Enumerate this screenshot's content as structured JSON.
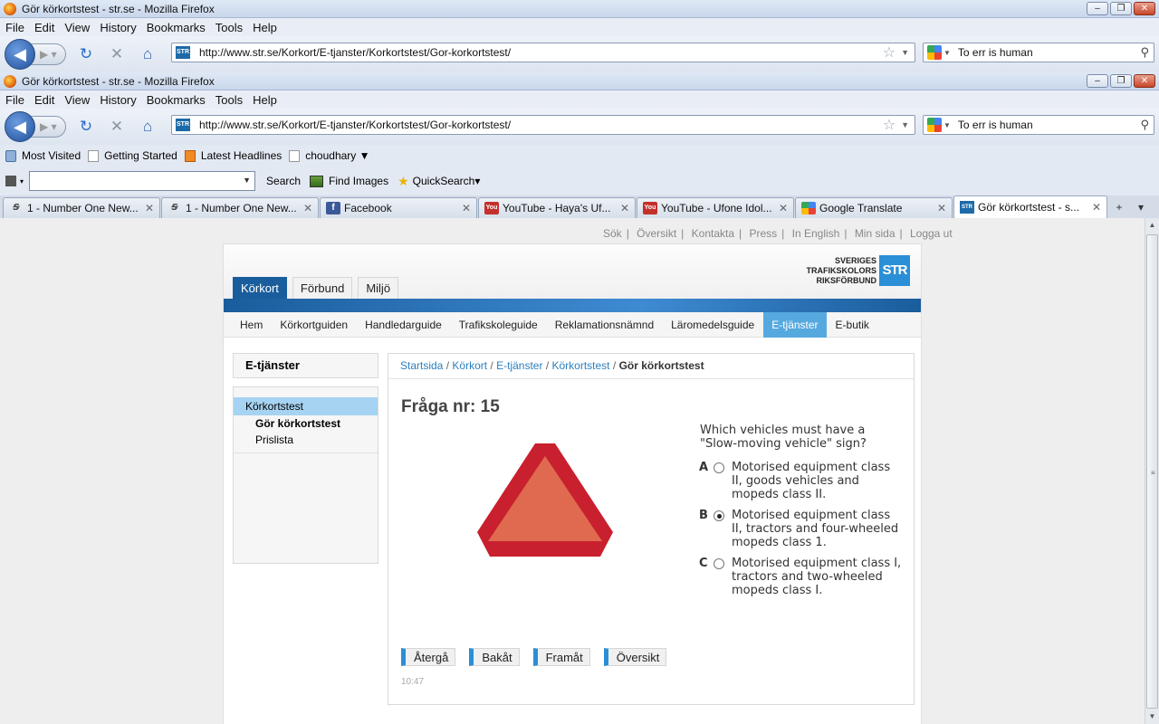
{
  "browser_back": {
    "title": "Gör körkortstest - str.se - Mozilla Firefox",
    "menu": [
      "File",
      "Edit",
      "View",
      "History",
      "Bookmarks",
      "Tools",
      "Help"
    ],
    "url": "http://www.str.se/Korkort/E-tjanster/Korkortstest/Gor-korkortstest/",
    "search": "To err is human"
  },
  "browser": {
    "title": "Gör körkortstest - str.se - Mozilla Firefox",
    "menu": [
      "File",
      "Edit",
      "View",
      "History",
      "Bookmarks",
      "Tools",
      "Help"
    ],
    "url": "http://www.str.se/Korkort/E-tjanster/Korkortstest/Gor-korkortstest/",
    "search": "To err is human",
    "bookmarks": [
      "Most Visited",
      "Getting Started",
      "Latest Headlines",
      "choudhary ▼"
    ],
    "toolbar": {
      "search_label": "Search",
      "images_label": "Find Images",
      "quicksearch_label": "QuickSearch▾"
    },
    "tabs": [
      {
        "label": "1 - Number One New...",
        "icon": "number-one-icon"
      },
      {
        "label": "1 - Number One New...",
        "icon": "number-one-icon"
      },
      {
        "label": "Facebook",
        "icon": "facebook-icon"
      },
      {
        "label": "YouTube - Haya's Uf...",
        "icon": "youtube-icon"
      },
      {
        "label": "YouTube - Ufone Idol...",
        "icon": "youtube-icon"
      },
      {
        "label": "Google Translate",
        "icon": "google-icon"
      },
      {
        "label": "Gör körkortstest - s...",
        "icon": "str-icon",
        "active": true
      }
    ]
  },
  "page": {
    "toplinks": [
      "Sök",
      "Översikt",
      "Kontakta",
      "Press",
      "In English",
      "Min sida",
      "Logga ut"
    ],
    "logo": {
      "line1": "SVERIGES",
      "line2": "TRAFIKSKOLORS",
      "line3": "RIKSFÖRBUND",
      "mark": "STR"
    },
    "main_tabs": [
      "Körkort",
      "Förbund",
      "Miljö"
    ],
    "subnav": [
      "Hem",
      "Körkortguiden",
      "Handledarguide",
      "Trafikskoleguide",
      "Reklamationsnämnd",
      "Läromedelsguide",
      "E-tjänster",
      "E-butik"
    ],
    "sidebar": {
      "title": "E-tjänster",
      "item": "Körkortstest",
      "sub_active": "Gör körkortstest",
      "sub": "Prislista"
    },
    "breadcrumb": [
      "Startsida",
      "Körkort",
      "E-tjänster",
      "Körkortstest"
    ],
    "breadcrumb_current": "Gör körkortstest",
    "question": {
      "title": "Fråga nr: 15",
      "text": "Which vehicles must have a \"Slow-moving vehicle\" sign?",
      "answers": [
        {
          "letter": "A",
          "text": "Motorised equipment class II, goods vehicles and mopeds class II.",
          "selected": false
        },
        {
          "letter": "B",
          "text": "Motorised equipment class II, tractors and four-wheeled mopeds class 1.",
          "selected": true
        },
        {
          "letter": "C",
          "text": "Motorised equipment class I, tractors and two-wheeled mopeds class I.",
          "selected": false
        }
      ]
    },
    "buttons": [
      "Återgå",
      "Bakåt",
      "Framåt",
      "Översikt"
    ],
    "timer": "10:47",
    "colors": {
      "accent": "#1a5d9c",
      "highlight": "#56a9df",
      "sign_border": "#c8202e",
      "sign_fill": "#e06a50"
    }
  }
}
